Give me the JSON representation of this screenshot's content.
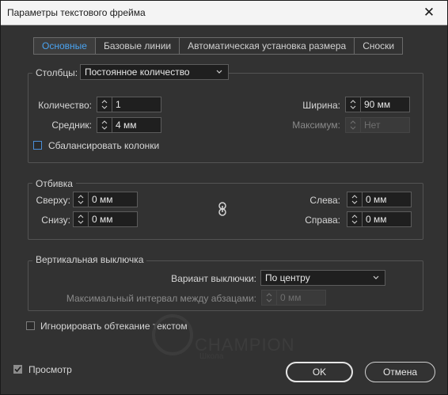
{
  "window": {
    "title": "Параметры текстового фрейма",
    "close_glyph": "✕"
  },
  "tabs": [
    "Основные",
    "Базовые линии",
    "Автоматическая установка размера",
    "Сноски"
  ],
  "columns": {
    "group_label": "Столбцы:",
    "type_value": "Постоянное количество",
    "count_label": "Количество:",
    "count_value": "1",
    "gutter_label": "Средник:",
    "gutter_value": "4 мм",
    "width_label": "Ширина:",
    "width_value": "90 мм",
    "max_label": "Максимум:",
    "max_value": "Нет",
    "balance_label": "Сбалансировать колонки"
  },
  "inset": {
    "group_label": "Отбивка",
    "top_label": "Сверху:",
    "top_value": "0 мм",
    "bottom_label": "Снизу:",
    "bottom_value": "0 мм",
    "left_label": "Слева:",
    "left_value": "0 мм",
    "right_label": "Справа:",
    "right_value": "0 мм",
    "link_icon": "chain-link-icon"
  },
  "vertical_justification": {
    "group_label": "Вертикальная выключка",
    "align_label": "Вариант выключки:",
    "align_value": "По центру",
    "para_spacing_label": "Максимальный интервал между абзацами:",
    "para_spacing_value": "0 мм"
  },
  "ignore_wrap_label": "Игнорировать обтекание текстом",
  "preview": {
    "label": "Просмотр",
    "checked": true
  },
  "buttons": {
    "ok": "OK",
    "cancel": "Отмена"
  },
  "watermark": {
    "line1": "CHAMPION",
    "line2": "Школа"
  }
}
